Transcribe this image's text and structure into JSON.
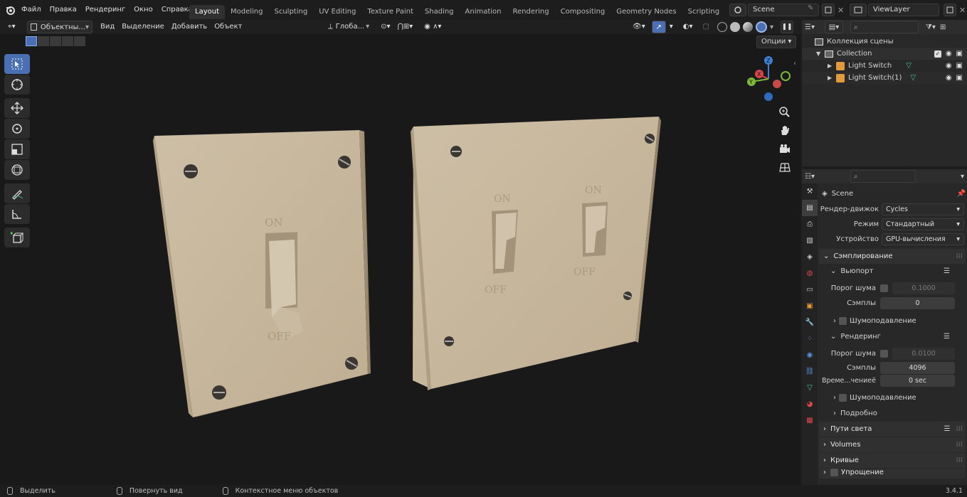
{
  "menu": [
    "Файл",
    "Правка",
    "Рендеринг",
    "Окно",
    "Справка"
  ],
  "workspaces": [
    "Layout",
    "Modeling",
    "Sculpting",
    "UV Editing",
    "Texture Paint",
    "Shading",
    "Animation",
    "Rendering",
    "Compositing",
    "Geometry Nodes",
    "Scripting"
  ],
  "active_workspace": "Layout",
  "scene_name": "Scene",
  "view_layer": "ViewLayer",
  "viewport_header": {
    "mode": "Объектны...",
    "view": "Вид",
    "select": "Выделение",
    "add": "Добавить",
    "object": "Объект",
    "transform_orientation": "Глоба...",
    "options": "Опции"
  },
  "outliner": {
    "root": "Коллекция сцены",
    "collection": "Collection",
    "objects": [
      "Light Switch",
      "Light Switch(1)"
    ]
  },
  "properties": {
    "context": "Scene",
    "render_engine_label": "Рендер-движок",
    "render_engine": "Cycles",
    "mode_label": "Режим",
    "mode": "Стандартный",
    "device_label": "Устройство",
    "device": "GPU-вычисления",
    "sampling": "Сэмплирование",
    "viewport": "Вьюпорт",
    "noise_threshold_label": "Порог шума",
    "viewport_noise": "0.1000",
    "samples_label": "Сэмплы",
    "viewport_samples": "0",
    "denoise": "Шумоподавление",
    "render": "Рендеринг",
    "render_noise": "0.0100",
    "render_samples": "4096",
    "time_limit_label": "Време...чениеё",
    "time_limit": "0 sec",
    "advanced": "Подробно",
    "light_paths": "Пути света",
    "volumes": "Volumes",
    "curves": "Кривые",
    "simplify": "Упрощение"
  },
  "statusbar": {
    "select": "Выделить",
    "rotate": "Повернуть вид",
    "context_menu": "Контекстное меню объектов",
    "version": "3.4.1"
  },
  "plate_labels": {
    "on": "ON",
    "off": "OFF"
  },
  "colors": {
    "accent": "#4a6fb3",
    "plate": "#c4b49a",
    "x_axis": "#d9464a",
    "y_axis": "#7db83a",
    "z_axis": "#3d7fd6",
    "object_icon": "#e39a3b",
    "mesh_icon": "#3fc4a0"
  }
}
